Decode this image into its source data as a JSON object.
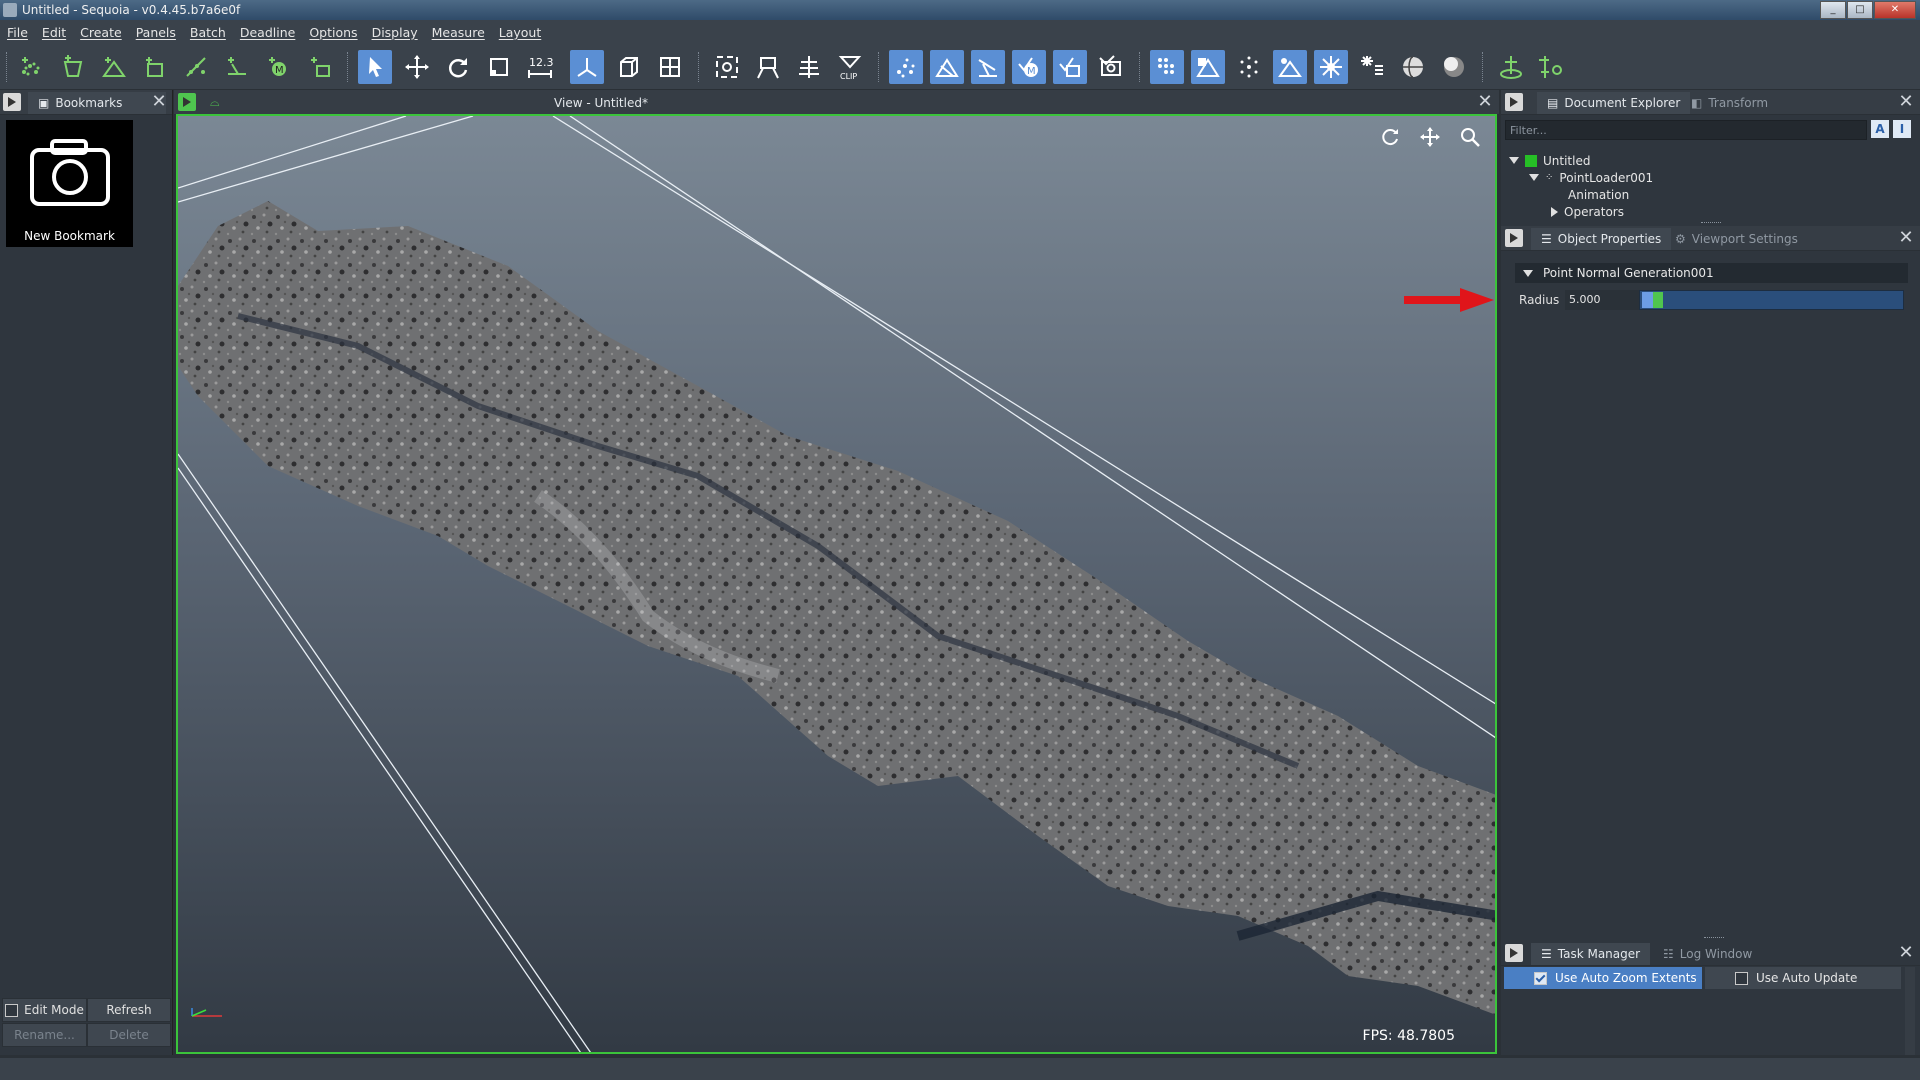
{
  "window": {
    "title": "Untitled - Sequoia - v0.4.45.b7a6e0f",
    "min": "_",
    "max": "□",
    "close": "✕"
  },
  "menu": [
    "File",
    "Edit",
    "Create",
    "Panels",
    "Batch",
    "Deadline",
    "Options",
    "Display",
    "Measure",
    "Layout"
  ],
  "toolbar": {
    "clip_label": "CLIP",
    "measure_label": "12.3"
  },
  "bookmarks": {
    "tab": "Bookmarks",
    "new_bookmark": "New Bookmark",
    "edit_mode": "Edit Mode",
    "refresh": "Refresh",
    "rename": "Rename...",
    "delete": "Delete"
  },
  "view": {
    "title": "View - Untitled*",
    "fps": "FPS:  48.7805"
  },
  "document_explorer": {
    "tab": "Document Explorer",
    "tab2": "Transform",
    "filter_placeholder": "Filter...",
    "filter_btn_a": "A",
    "filter_btn_i": "I",
    "tree": [
      {
        "label": "Untitled"
      },
      {
        "label": "PointLoader001"
      },
      {
        "label": "Animation"
      },
      {
        "label": "Operators"
      }
    ]
  },
  "object_properties": {
    "tab": "Object Properties",
    "tab2": "Viewport Settings",
    "group": "Point Normal Generation001",
    "radius_label": "Radius",
    "radius_value": "5.000"
  },
  "task_manager": {
    "tab": "Task Manager",
    "tab2": "Log Window",
    "auto_zoom": "Use Auto Zoom Extents",
    "auto_update": "Use Auto Update"
  },
  "colors": {
    "accent": "#5b8fd4",
    "viewport_border": "#3bc43b",
    "arrow": "#e0151a"
  }
}
